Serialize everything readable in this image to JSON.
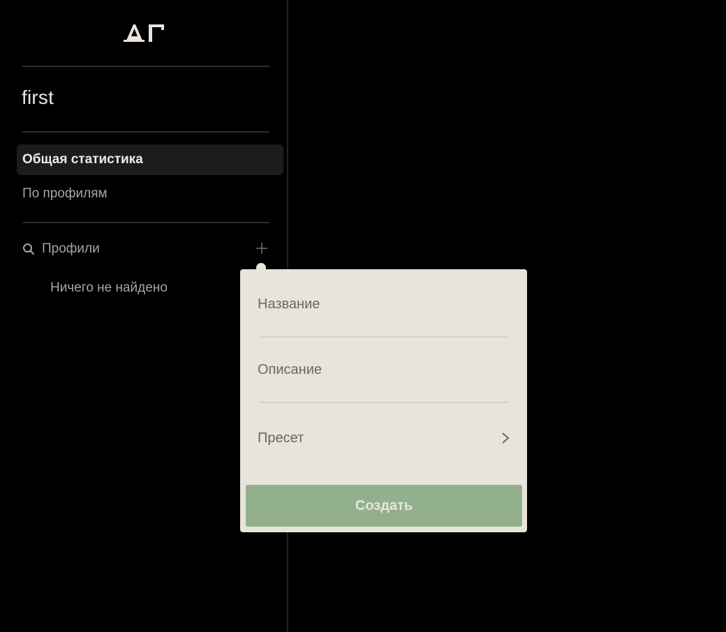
{
  "sidebar": {
    "logo_text": "ΔΓ",
    "project_name": "first",
    "nav": [
      {
        "label": "Общая статистика",
        "active": true
      },
      {
        "label": "По профилям",
        "active": false
      }
    ],
    "profiles": {
      "label": "Профили",
      "search_icon": "search-icon",
      "add_icon": "plus-icon",
      "empty_text": "Ничего не найдено"
    }
  },
  "popover": {
    "name_placeholder": "Название",
    "description_placeholder": "Описание",
    "preset_label": "Пресет",
    "preset_icon": "chevron-right-icon",
    "create_label": "Создать"
  },
  "colors": {
    "background": "#000000",
    "popover_bg": "#e8e4da",
    "accent_green": "#92b08b",
    "active_item_bg": "#1c1c1c"
  }
}
